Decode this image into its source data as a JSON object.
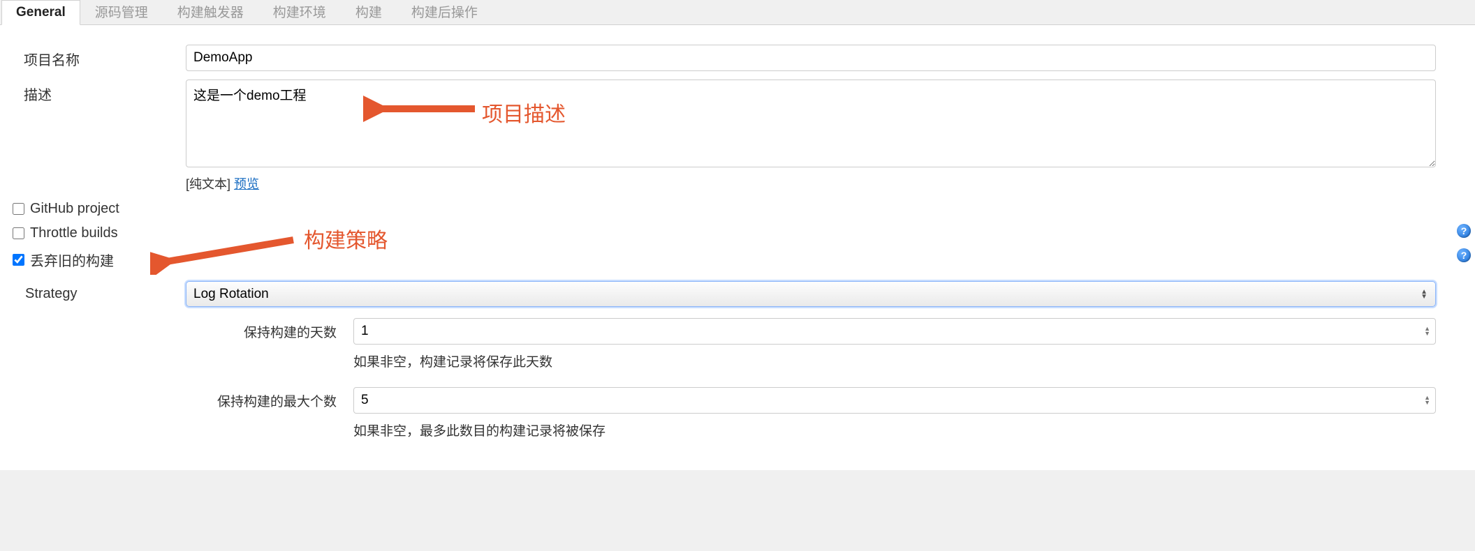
{
  "tabs": [
    {
      "label": "General",
      "active": true
    },
    {
      "label": "源码管理"
    },
    {
      "label": "构建触发器"
    },
    {
      "label": "构建环境"
    },
    {
      "label": "构建"
    },
    {
      "label": "构建后操作"
    }
  ],
  "form": {
    "project_name_label": "项目名称",
    "project_name_value": "DemoApp",
    "description_label": "描述",
    "description_value": "这是一个demo工程",
    "desc_footer_plain": "[纯文本] ",
    "desc_footer_link": "预览"
  },
  "checkboxes": {
    "github_label": "GitHub project",
    "github_checked": false,
    "throttle_label": "Throttle builds",
    "throttle_checked": false,
    "discard_label": "丢弃旧的构建",
    "discard_checked": true
  },
  "strategy": {
    "label": "Strategy",
    "selected": "Log Rotation",
    "days_label": "保持构建的天数",
    "days_value": "1",
    "days_help": "如果非空，构建记录将保存此天数",
    "max_label": "保持构建的最大个数",
    "max_value": "5",
    "max_help": "如果非空，最多此数目的构建记录将被保存"
  },
  "annotations": {
    "desc_text": "项目描述",
    "strategy_text": "构建策略"
  },
  "help_glyph": "?"
}
